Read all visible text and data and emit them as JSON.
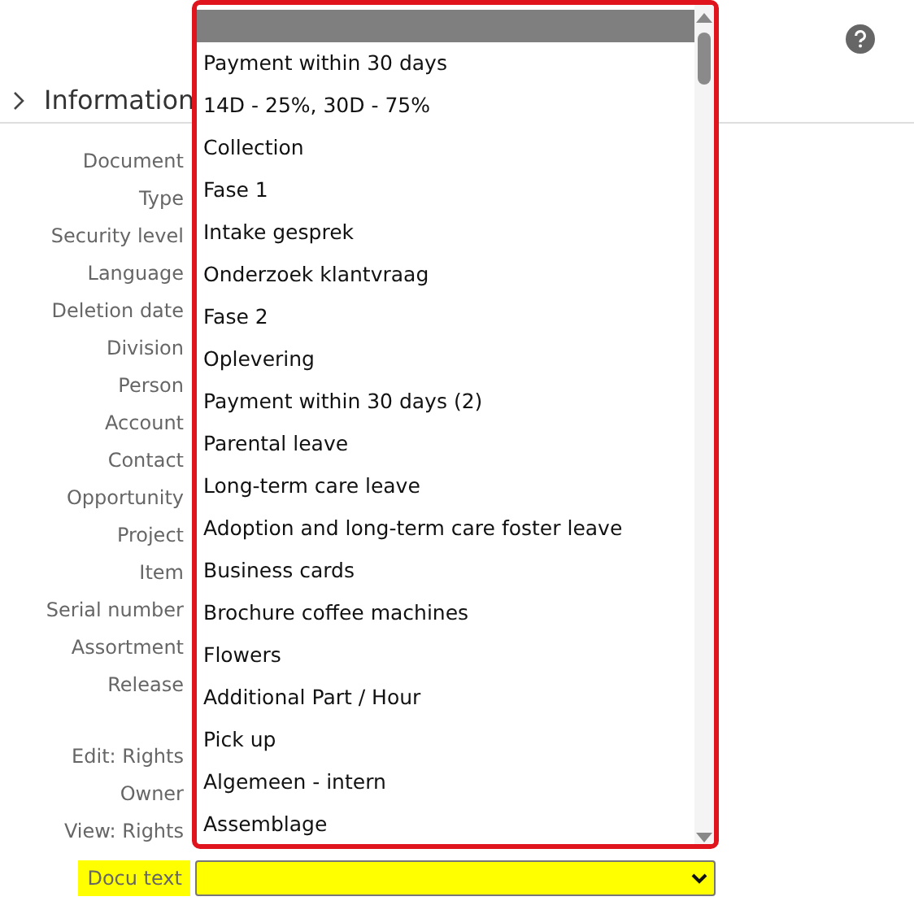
{
  "header": {
    "title": "Information",
    "expanded": false
  },
  "label_groups": [
    [
      "Document",
      "Type",
      "Security level",
      "Language",
      "Deletion date",
      "Division",
      "Person",
      "Account",
      "Contact",
      "Opportunity",
      "Project",
      "Item",
      "Serial number",
      "Assortment",
      "Release"
    ],
    [
      "Edit: Rights",
      "Owner",
      "View: Rights"
    ]
  ],
  "docu_text": {
    "label": "Docu text",
    "highlighted": true
  },
  "dropdown": {
    "options": [
      {
        "selected": true
      },
      {
        "label": "Payment within 30 days",
        "selected": false
      },
      {
        "label": "14D - 25%, 30D - 75%",
        "selected": false
      },
      {
        "label": "Collection",
        "selected": false
      },
      {
        "label": "Fase 1",
        "selected": false
      },
      {
        "label": "Intake gesprek",
        "selected": false
      },
      {
        "label": "Onderzoek klantvraag",
        "selected": false
      },
      {
        "label": "Fase 2",
        "selected": false
      },
      {
        "label": "Oplevering",
        "selected": false
      },
      {
        "label": "Payment within 30 days (2)",
        "selected": false
      },
      {
        "label": "Parental leave",
        "selected": false
      },
      {
        "label": "Long-term care leave",
        "selected": false
      },
      {
        "label": "Adoption and long-term care foster leave",
        "selected": false
      },
      {
        "label": "Business cards",
        "selected": false
      },
      {
        "label": "Brochure coffee machines",
        "selected": false
      },
      {
        "label": "Flowers",
        "selected": false
      },
      {
        "label": "Additional Part / Hour",
        "selected": false
      },
      {
        "label": "Pick up",
        "selected": false
      },
      {
        "label": "Algemeen - intern",
        "selected": false
      },
      {
        "label": "Assemblage",
        "selected": false
      }
    ]
  }
}
